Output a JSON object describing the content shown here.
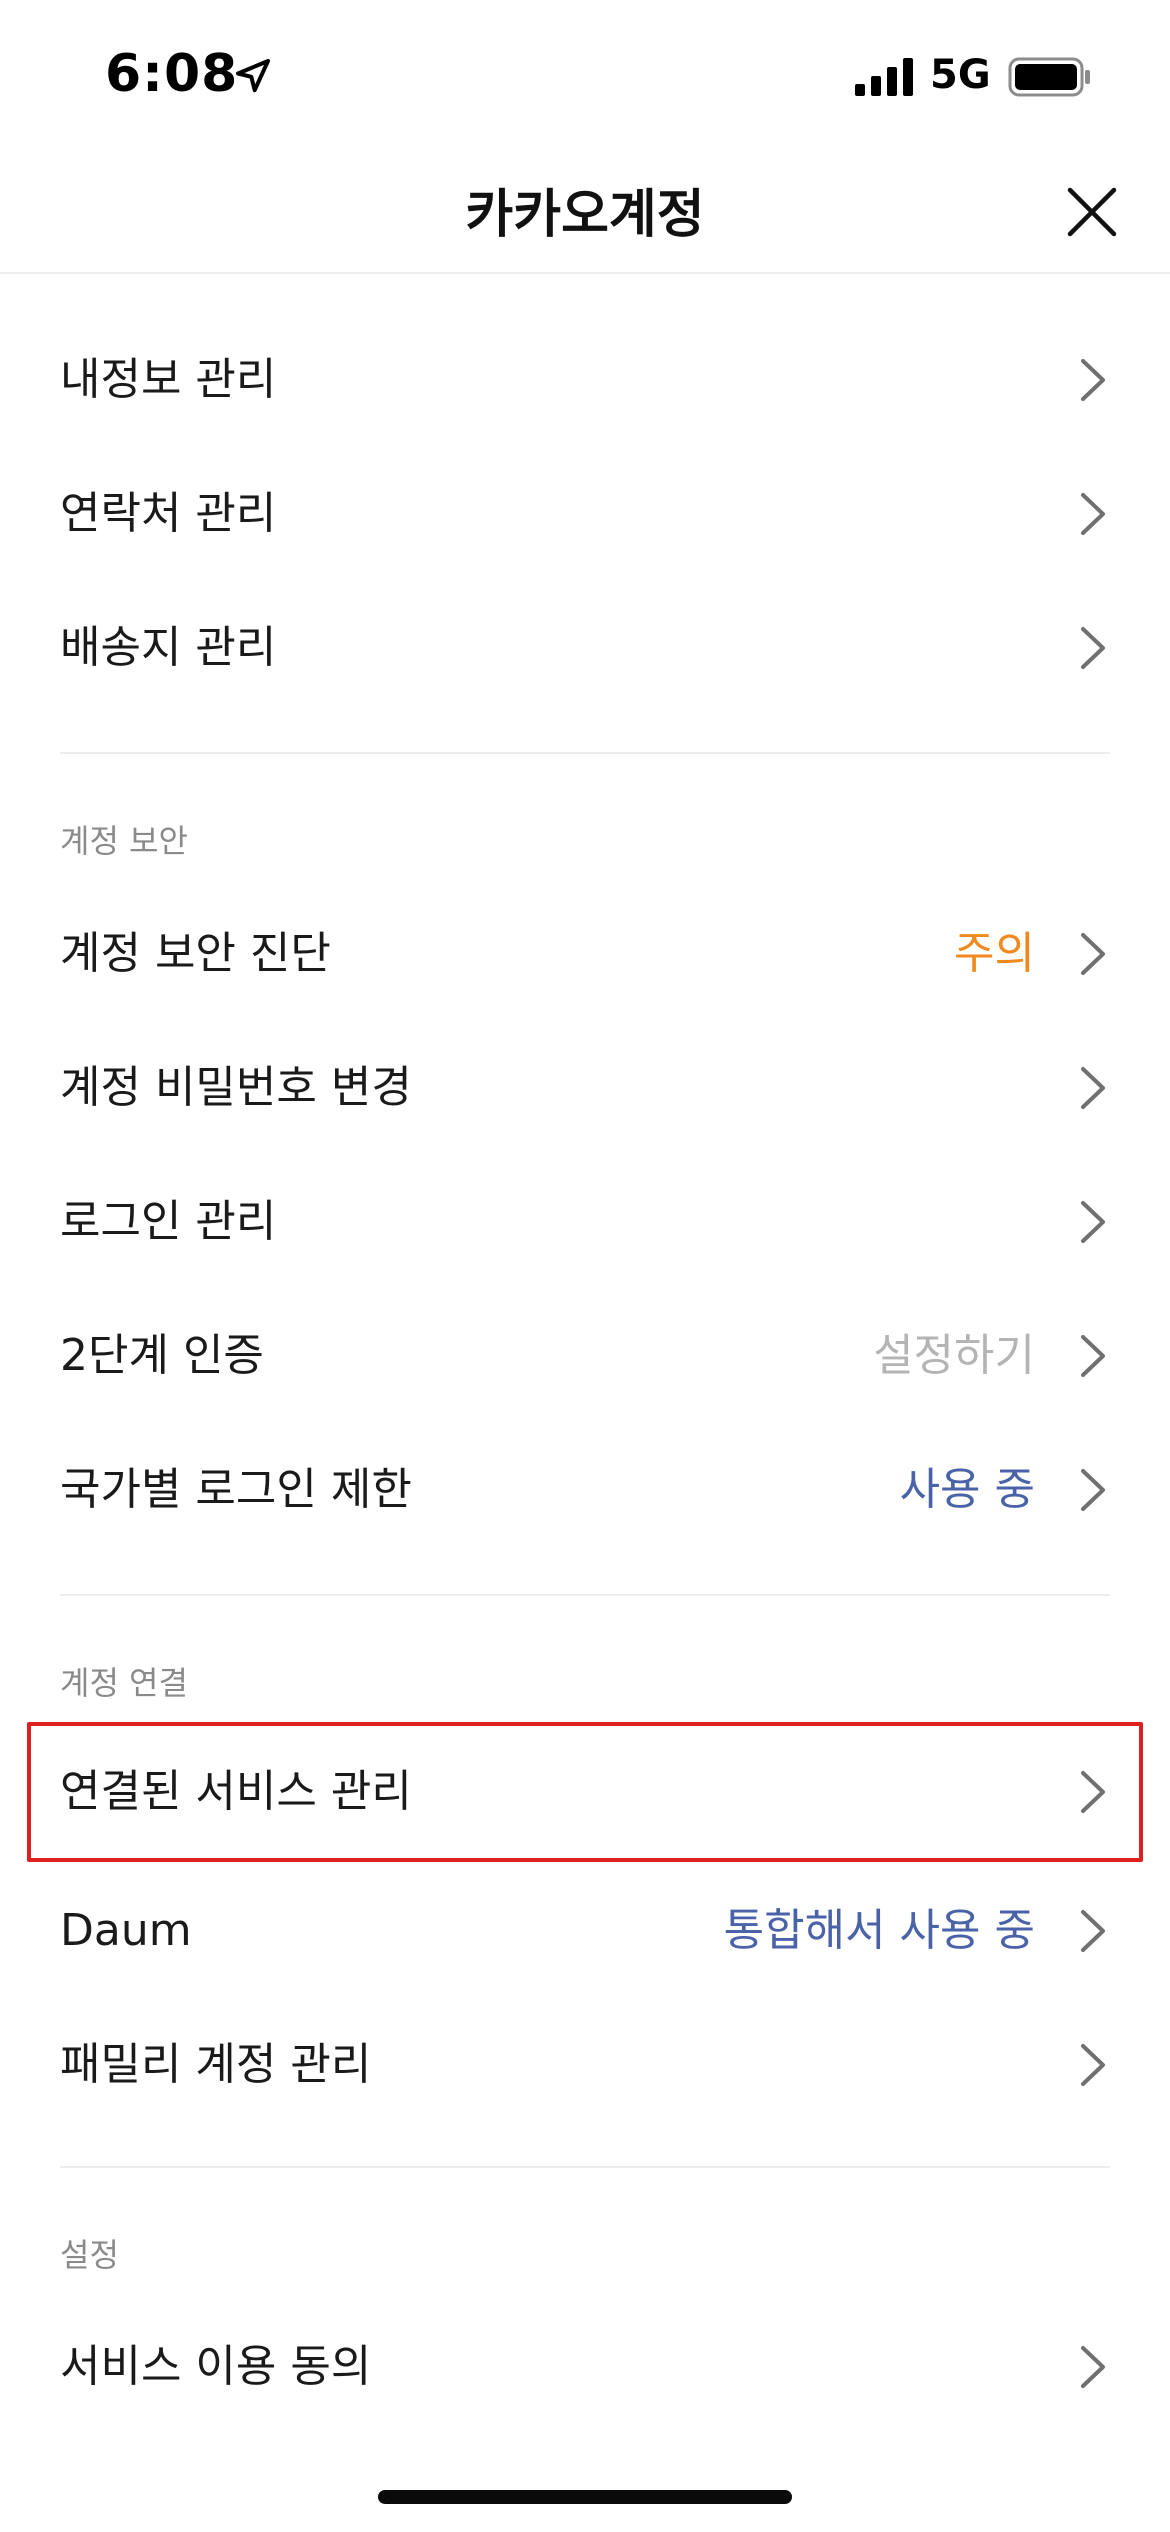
{
  "status_bar": {
    "time": "6:08",
    "network": "5G",
    "icons": [
      "location-arrow-icon",
      "cellular-signal-icon",
      "battery-icon"
    ]
  },
  "nav": {
    "title": "카카오계정",
    "close_icon": "close-icon"
  },
  "colors": {
    "warning": "#F08A1E",
    "muted": "#B4B4B4",
    "info": "#4A62A8",
    "highlight": "#E02020",
    "section": "#8A8A8A"
  },
  "menu": {
    "general": [
      {
        "label": "내정보 관리",
        "status": ""
      },
      {
        "label": "연락처 관리",
        "status": ""
      },
      {
        "label": "배송지 관리",
        "status": ""
      }
    ],
    "security": {
      "header": "계정 보안",
      "items": [
        {
          "label": "계정 보안 진단",
          "status": "주의"
        },
        {
          "label": "계정 비밀번호 변경",
          "status": ""
        },
        {
          "label": "로그인 관리",
          "status": ""
        },
        {
          "label": "2단계 인증",
          "status": "설정하기"
        },
        {
          "label": "국가별 로그인 제한",
          "status": "사용 중"
        }
      ]
    },
    "connection": {
      "header": "계정 연결",
      "items": [
        {
          "label": "연결된 서비스 관리",
          "status": ""
        },
        {
          "label": "Daum",
          "status": "통합해서 사용 중"
        },
        {
          "label": "패밀리 계정 관리",
          "status": ""
        }
      ]
    },
    "settings": {
      "header": "설정",
      "items": [
        {
          "label": "서비스 이용 동의",
          "status": ""
        }
      ]
    }
  }
}
